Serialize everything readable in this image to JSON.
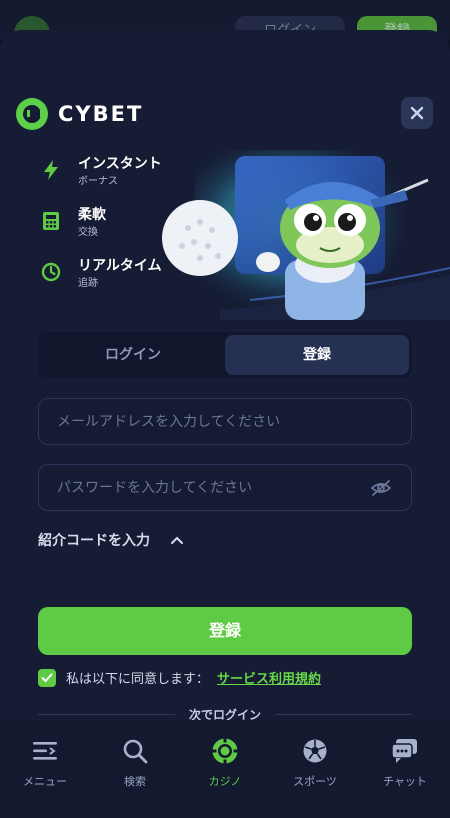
{
  "background": {
    "login_label": "ログイン",
    "signup_label": "登録"
  },
  "brand": {
    "name": "CYBET"
  },
  "close": {
    "icon": "close-icon"
  },
  "features": [
    {
      "icon": "lightning-icon",
      "title": "インスタント",
      "subtitle": "ボーナス"
    },
    {
      "icon": "calculator-icon",
      "title": "柔軟",
      "subtitle": "交換"
    },
    {
      "icon": "clock-icon",
      "title": "リアルタイム",
      "subtitle": "追跡"
    }
  ],
  "tabs": [
    {
      "label": "ログイン",
      "active": false
    },
    {
      "label": "登録",
      "active": true
    }
  ],
  "form": {
    "email_placeholder": "メールアドレスを入力してください",
    "email_value": "",
    "password_placeholder": "パスワードを入力してください",
    "password_value": "",
    "referral_label": "紹介コードを入力",
    "submit_label": "登録",
    "agree_text": "私は以下に同意します：",
    "terms_link": "サービス利用規約",
    "agree_checked": true,
    "divider_text": "次でログイン"
  },
  "bottom_nav": [
    {
      "icon": "menu-icon",
      "label": "メニュー",
      "active": false
    },
    {
      "icon": "search-icon",
      "label": "検索",
      "active": false
    },
    {
      "icon": "casino-chip-icon",
      "label": "カジノ",
      "active": true
    },
    {
      "icon": "soccer-ball-icon",
      "label": "スポーツ",
      "active": false
    },
    {
      "icon": "chat-icon",
      "label": "チャット",
      "active": false
    }
  ],
  "colors": {
    "accent": "#5fcb45",
    "background": "#151c33",
    "tab_active": "#263053"
  }
}
